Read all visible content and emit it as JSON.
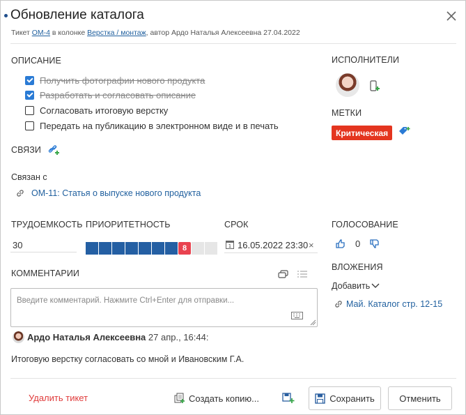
{
  "header": {
    "title": "Обновление каталога",
    "subtitle_prefix": "Тикет ",
    "ticket_id": "OM-4",
    "subtitle_mid": " в колонке ",
    "column": "Верстка / монтаж",
    "subtitle_suffix": ", автор Ардо Наталья Алексеевна 27.04.2022"
  },
  "description": {
    "label": "ОПИСАНИЕ",
    "checklist": [
      {
        "label": "Получить фотографии нового продукта",
        "done": true
      },
      {
        "label": "Разработать и согласовать описание",
        "done": true
      },
      {
        "label": "Согласовать итоговую верстку",
        "done": false
      },
      {
        "label": "Передать на публикацию в электронном виде и в печать",
        "done": false
      }
    ]
  },
  "links": {
    "label": "СВЯЗИ",
    "related_label": "Связан с",
    "items": [
      {
        "text": "OM-11: Статья о выпуске нового продукта"
      }
    ]
  },
  "effort": {
    "label": "ТРУДОЕМКОСТЬ",
    "value": "30"
  },
  "priority": {
    "label": "ПРИОРИТЕТНОСТЬ",
    "value": 8,
    "value_text": "8",
    "max": 10
  },
  "due": {
    "label": "СРОК",
    "value": "16.05.2022 23:30",
    "clear": "×"
  },
  "comments": {
    "label": "КОММЕНТАРИИ",
    "placeholder": "Введите комментарий. Нажмите Ctrl+Enter для отправки...",
    "items": [
      {
        "author": "Ардо Наталья Алексеевна",
        "date": "27 апр., 16:44:",
        "text": "Итоговую верстку согласовать со мной и Ивановским Г.А."
      }
    ]
  },
  "assignees": {
    "label": "ИСПОЛНИТЕЛИ"
  },
  "tags": {
    "label": "МЕТКИ",
    "items": [
      "Критическая"
    ],
    "tag_color": "#e4351f"
  },
  "voting": {
    "label": "ГОЛОСОВАНИЕ",
    "count": "0"
  },
  "attachments": {
    "label": "ВЛОЖЕНИЯ",
    "add_label": "Добавить",
    "items": [
      "Май. Каталог стр. 12-15"
    ]
  },
  "footer": {
    "delete": "Удалить тикет",
    "copy": "Создать копию...",
    "save": "Сохранить",
    "cancel": "Отменить"
  },
  "colors": {
    "accent": "#245fa3",
    "danger": "#e9424f",
    "link": "#1f5f9e"
  }
}
